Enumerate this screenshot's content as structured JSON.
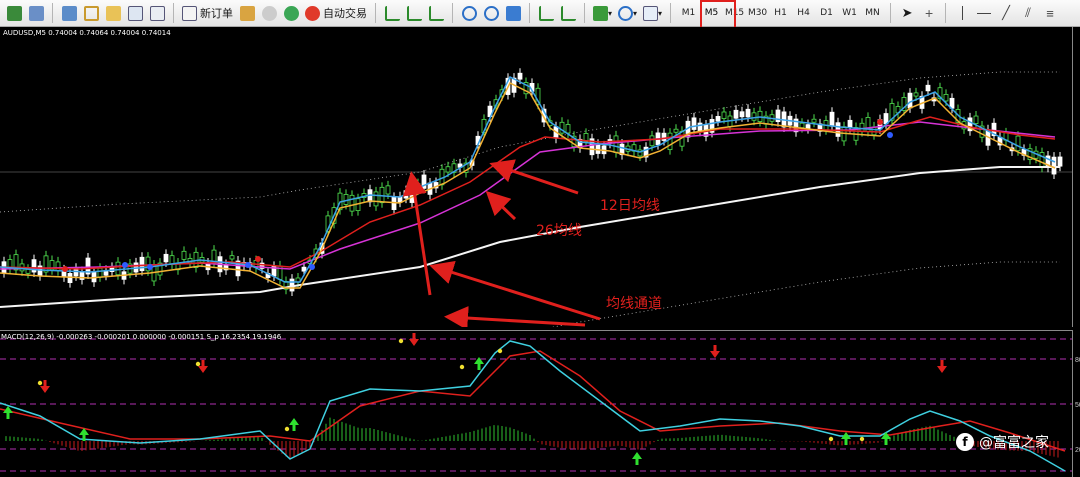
{
  "toolbar": {
    "new_order_label": "新订单",
    "auto_trading_label": "自动交易",
    "timeframes": [
      "M1",
      "M5",
      "M15",
      "M30",
      "H1",
      "H4",
      "D1",
      "W1",
      "MN"
    ],
    "active_timeframe": "M5"
  },
  "main_chart": {
    "title": "AUDUSD,M5  0.74004 0.74064 0.74004 0.74014"
  },
  "macd_chart": {
    "title": "MACD(12,26,9) -0.000263 -0.000201 0.000000 -0.000151  S_p 16.2354 19.1946",
    "scale_labels": [
      "80",
      "50",
      "20"
    ]
  },
  "annotations": {
    "ma12": "12日均线",
    "ma26": "26均线",
    "channel": "均线通道"
  },
  "watermark": {
    "text": "@富富之家"
  },
  "colors": {
    "ma_fast": "#f2b233",
    "ma_mid": "#e0201d",
    "ma_slow": "#d633d6",
    "ma_long": "#f5f5f5",
    "price_line": "#3ba3e8",
    "candle": "#4fe04f",
    "arrow": "#e0201d",
    "macd_grid": "#b030b0"
  }
}
